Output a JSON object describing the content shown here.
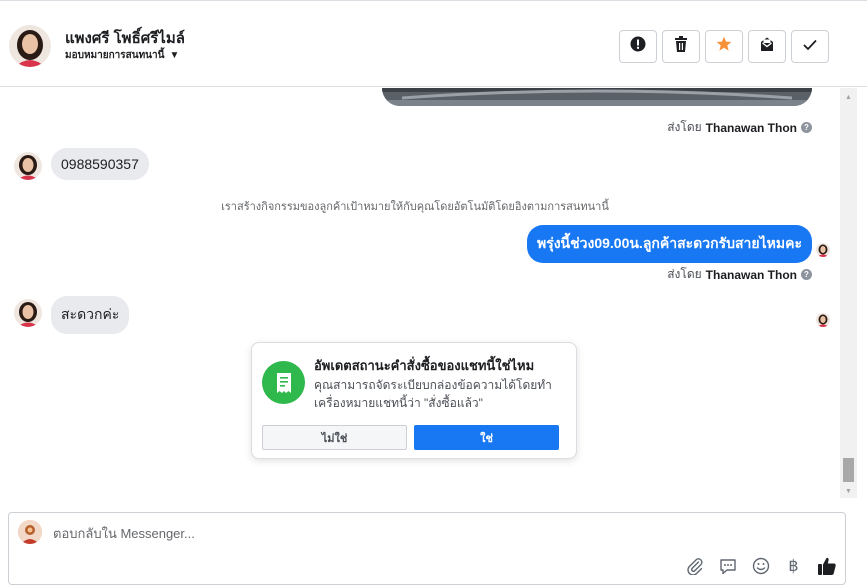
{
  "header": {
    "contact_name": "แพงศรี โพธิ์ศรีไมล์",
    "assign_label": "มอบหมายการสนทนานี้"
  },
  "thread": {
    "sender_name": "Thanawan Thon",
    "sent_by_prefix": "ส่งโดย",
    "messages": [
      {
        "text": "0988590357"
      },
      {
        "text": "พรุ่งนี้ช่วง09.00น.ลูกค้าสะดวกรับสายไหมคะ"
      },
      {
        "text": "สะดวกค่ะ"
      }
    ],
    "system_note": "เราสร้างกิจกรรมของลูกค้าเป้าหมายให้กับคุณโดยอัตโนมัติโดยอิงตามการสนทนานี้"
  },
  "popup": {
    "title": "อัพเดตสถานะคำสั่งซื้อของแชทนี้ใช่ไหม",
    "body": "คุณสามารถจัดระเบียบกล่องข้อความได้โดยทำเครื่องหมายแชทนี้ว่า \"สั่งซื้อแล้ว\"",
    "no_label": "ไม่ใช่",
    "yes_label": "ใช่"
  },
  "composer": {
    "placeholder": "ตอบกลับใน Messenger...",
    "baht_symbol": "฿"
  },
  "colors": {
    "accent": "#1877f2",
    "star": "#f7923b",
    "success": "#2fb84c"
  },
  "icons": {
    "header_actions": [
      "alert-icon",
      "trash-icon",
      "star-icon",
      "mail-icon",
      "check-icon"
    ],
    "composer_tools": [
      "paperclip-icon",
      "saved-reply-icon",
      "emoji-icon",
      "baht-icon",
      "thumbs-up-icon"
    ]
  }
}
